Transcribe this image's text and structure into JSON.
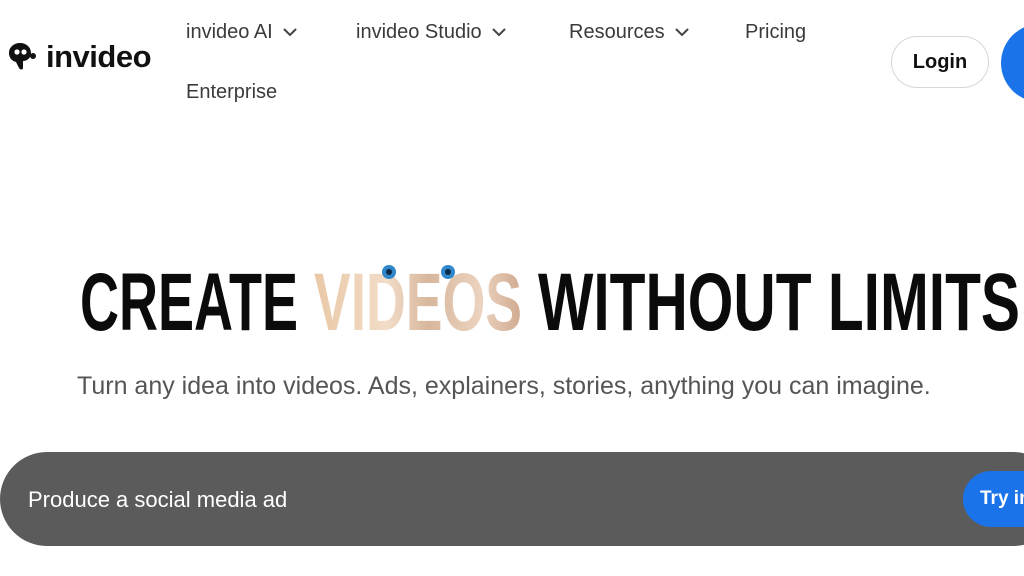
{
  "header": {
    "brand": "invideo",
    "logo_icon": "invideo-logo-icon",
    "nav": [
      {
        "label": "invideo AI",
        "has_dropdown": true
      },
      {
        "label": "invideo Studio",
        "has_dropdown": true
      },
      {
        "label": "Resources",
        "has_dropdown": true
      },
      {
        "label": "Pricing",
        "has_dropdown": false
      },
      {
        "label": "Enterprise",
        "has_dropdown": false
      }
    ],
    "login_label": "Login"
  },
  "hero": {
    "title_word_1": "CREATE",
    "title_word_2": "VIDEOS",
    "title_word_3": "WITHOUT LIMITS",
    "subtitle": "Turn any idea into videos. Ads, explainers, stories, anything you can imagine."
  },
  "prompt": {
    "value": "Produce a social media ad",
    "button_label": "Try invideo AI"
  },
  "colors": {
    "accent": "#1a73e8",
    "prompt_bar": "#5b5b5b",
    "title": "#0b0b0b",
    "subtitle": "#555555"
  }
}
